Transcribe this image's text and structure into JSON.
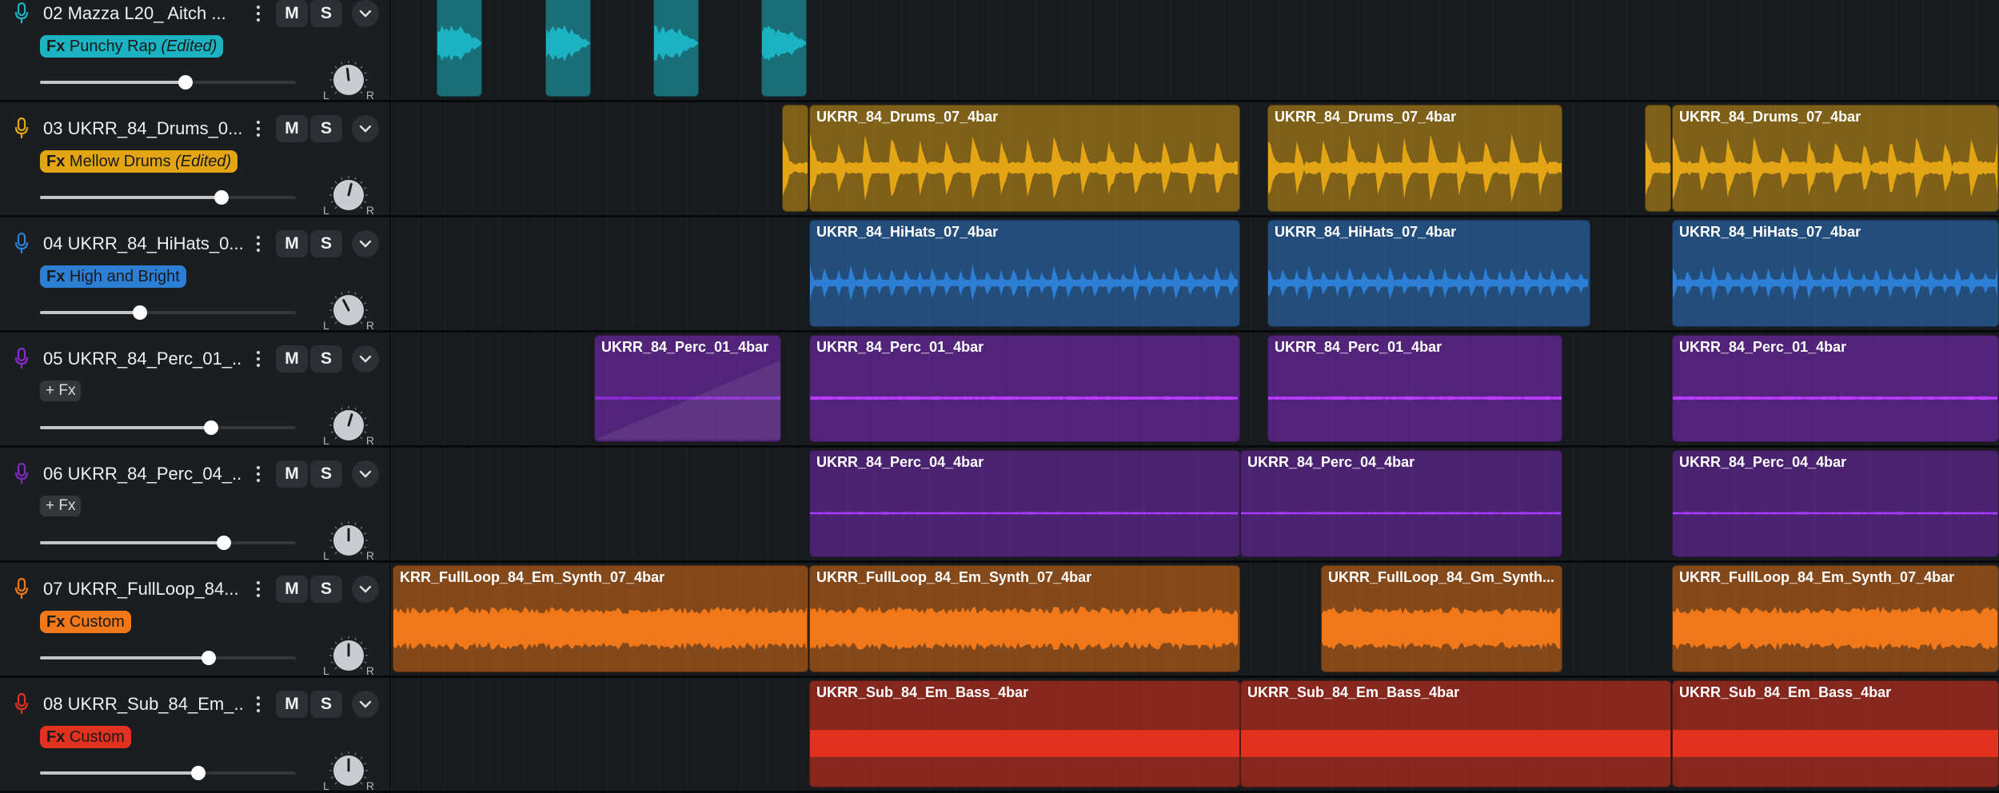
{
  "tracks": [
    {
      "number": "02",
      "name": "Mazza L20_ Aitch ...",
      "color": "#1bb3c2",
      "fx_prefix": "Fx",
      "fx_name": "Punchy Rap",
      "fx_edited": "(Edited)",
      "volume": 0.57,
      "pan": -0.05,
      "clips": [
        {
          "title": "",
          "start": 546,
          "end": 603,
          "style": "transient"
        },
        {
          "title": "",
          "start": 682,
          "end": 739,
          "style": "transient"
        },
        {
          "title": "",
          "start": 817,
          "end": 874,
          "style": "transient"
        },
        {
          "title": "",
          "start": 952,
          "end": 1009,
          "style": "transient"
        }
      ]
    },
    {
      "number": "03",
      "name": "UKRR_84_Drums_0...",
      "color": "#e3a514",
      "fx_prefix": "Fx",
      "fx_name": "Mellow Drums",
      "fx_edited": "(Edited)",
      "volume": 0.71,
      "pan": 0.1,
      "clips": [
        {
          "title": "",
          "start": 978,
          "end": 1011,
          "style": "drums"
        },
        {
          "title": "UKRR_84_Drums_07_4bar",
          "start": 1012,
          "end": 1551,
          "style": "drums"
        },
        {
          "title": "UKRR_84_Drums_07_4bar",
          "start": 1585,
          "end": 1954,
          "style": "drums"
        },
        {
          "title": "",
          "start": 2057,
          "end": 2090,
          "style": "drums"
        },
        {
          "title": "UKRR_84_Drums_07_4bar",
          "start": 2091,
          "end": 2500,
          "style": "drums"
        }
      ]
    },
    {
      "number": "04",
      "name": "UKRR_84_HiHats_0...",
      "color": "#2d7fd6",
      "fx_prefix": "Fx",
      "fx_name": "High and Bright",
      "fx_edited": "",
      "volume": 0.39,
      "pan": -0.2,
      "clips": [
        {
          "title": "UKRR_84_HiHats_07_4bar",
          "start": 1012,
          "end": 1551,
          "style": "hats"
        },
        {
          "title": "UKRR_84_HiHats_07_4bar",
          "start": 1585,
          "end": 1989,
          "style": "hats"
        },
        {
          "title": "UKRR_84_HiHats_07_4bar",
          "start": 2091,
          "end": 2500,
          "style": "hats"
        }
      ]
    },
    {
      "number": "05",
      "name": "UKRR_84_Perc_01_...",
      "color": "#8a2bd4",
      "fx_prefix": "",
      "fx_name": "+ Fx",
      "fx_edited": "",
      "volume": 0.67,
      "pan": 0.12,
      "clips": [
        {
          "title": "UKRR_84_Perc_01_4bar",
          "start": 743,
          "end": 977,
          "style": "fadein"
        },
        {
          "title": "UKRR_84_Perc_01_4bar",
          "start": 1012,
          "end": 1551,
          "style": "line"
        },
        {
          "title": "UKRR_84_Perc_01_4bar",
          "start": 1585,
          "end": 1954,
          "style": "line"
        },
        {
          "title": "UKRR_84_Perc_01_4bar",
          "start": 2091,
          "end": 2500,
          "style": "line"
        }
      ]
    },
    {
      "number": "06",
      "name": "UKRR_84_Perc_04_...",
      "color": "#7d2ac2",
      "fx_prefix": "",
      "fx_name": "+ Fx",
      "fx_edited": "",
      "volume": 0.72,
      "pan": 0.0,
      "clips": [
        {
          "title": "UKRR_84_Perc_04_4bar",
          "start": 1012,
          "end": 1551,
          "style": "thin"
        },
        {
          "title": "UKRR_84_Perc_04_4bar",
          "start": 1551,
          "end": 1954,
          "style": "thin"
        },
        {
          "title": "UKRR_84_Perc_04_4bar",
          "start": 2091,
          "end": 2500,
          "style": "thin"
        }
      ]
    },
    {
      "number": "07",
      "name": "UKRR_FullLoop_84...",
      "color": "#f07818",
      "fx_prefix": "Fx",
      "fx_name": "Custom",
      "fx_edited": "",
      "volume": 0.66,
      "pan": 0.0,
      "clips": [
        {
          "title": "KRR_FullLoop_84_Em_Synth_07_4bar",
          "start": 491,
          "end": 1011,
          "style": "dense"
        },
        {
          "title": "UKRR_FullLoop_84_Em_Synth_07_4bar",
          "start": 1012,
          "end": 1551,
          "style": "dense"
        },
        {
          "title": "UKRR_FullLoop_84_Gm_Synth...",
          "start": 1652,
          "end": 1954,
          "style": "dense"
        },
        {
          "title": "UKRR_FullLoop_84_Em_Synth_07_4bar",
          "start": 2091,
          "end": 2500,
          "style": "dense"
        }
      ]
    },
    {
      "number": "08",
      "name": "UKRR_Sub_84_Em_...",
      "color": "#e2321f",
      "fx_prefix": "Fx",
      "fx_name": "Custom",
      "fx_edited": "",
      "volume": 0.62,
      "pan": 0.0,
      "clips": [
        {
          "title": "UKRR_Sub_84_Em_Bass_4bar",
          "start": 1012,
          "end": 1551,
          "style": "sub"
        },
        {
          "title": "UKRR_Sub_84_Em_Bass_4bar",
          "start": 1551,
          "end": 2090,
          "style": "sub"
        },
        {
          "title": "UKRR_Sub_84_Em_Bass_4bar",
          "start": 2091,
          "end": 2500,
          "style": "sub"
        }
      ]
    }
  ],
  "controls": {
    "mute_label": "M",
    "solo_label": "S",
    "pan_left_label": "L",
    "pan_right_label": "R"
  },
  "icons": {
    "track_icon": "microphone-icon",
    "menu_icon": "more-vertical-icon",
    "expand_icon": "chevron-down-icon"
  }
}
